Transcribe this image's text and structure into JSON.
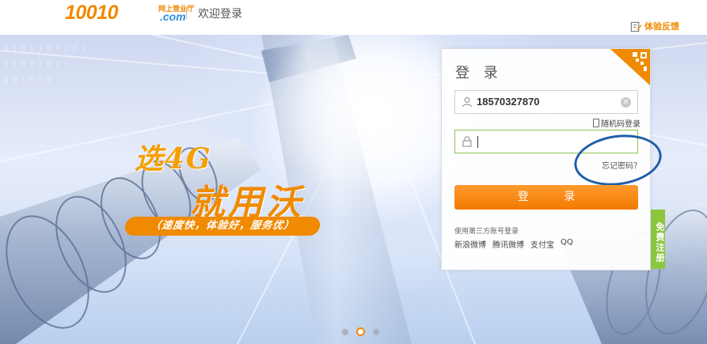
{
  "header": {
    "logo_number": "10010",
    "logo_tagline": "网上营业厅",
    "logo_suffix": ".com",
    "welcome": "欢迎登录",
    "feedback_label": "体验反馈"
  },
  "banner": {
    "slogan_line1": "选4G",
    "slogan_line2": "就用沃",
    "slogan_tag": "（速度快，体验好，服务优）",
    "carousel": {
      "count": 3,
      "active_index": 1
    }
  },
  "login": {
    "title": "登 录",
    "username_value": "18570327870",
    "password_value": "",
    "random_code_login": "随机码登录",
    "forgot_password": "忘记密码？",
    "submit_label": "登 录",
    "third_party_title": "使用第三方账号登录",
    "third_party_links": [
      "新浪微博",
      "腾讯微博",
      "支付宝",
      "QQ"
    ],
    "register_label": "免费注册"
  },
  "colors": {
    "brand_orange": "#f08a00",
    "brand_blue": "#2e8fd8",
    "register_green": "#8cc63f",
    "annotation_blue": "#1f5fa8"
  }
}
